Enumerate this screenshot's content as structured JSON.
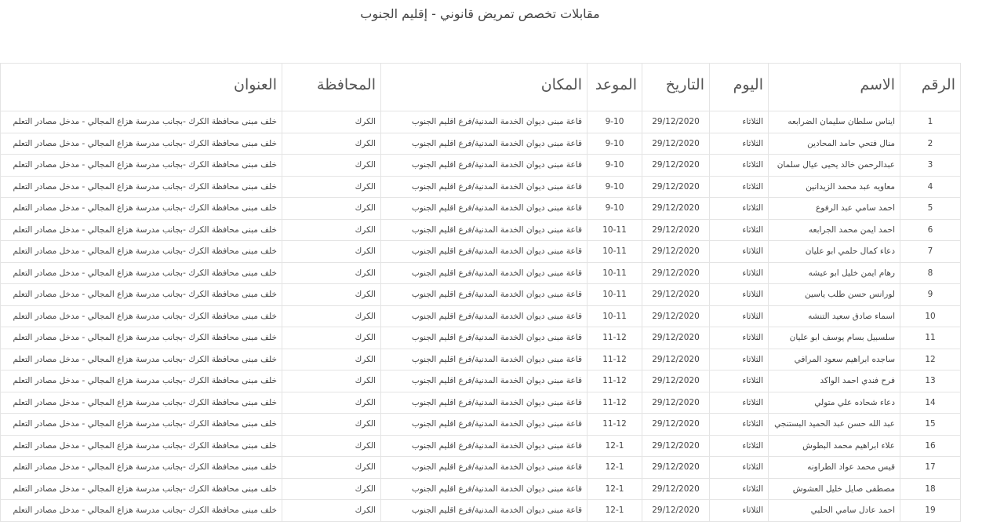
{
  "page": {
    "title": "مقابلات تخصص تمريض قانوني - إقليم الجنوب"
  },
  "table": {
    "headers": [
      "الرقم",
      "الاسم",
      "اليوم",
      "التاريخ",
      "الموعد",
      "المكان",
      "المحافظة",
      "العنوان"
    ],
    "rows": [
      [
        "1",
        "ايناس سلطان سليمان الضرابعه",
        "الثلاثاء",
        "29/12/2020",
        "9-10",
        "قاعة مبنى ديوان الخدمة المدنية/فرع اقليم الجنوب",
        "الكرك",
        "خلف مبنى محافظة الكرك -بجانب مدرسة هزاع المجالي - مدخل مصادر التعلم"
      ],
      [
        "2",
        "منال فتحي حامد المحادين",
        "الثلاثاء",
        "29/12/2020",
        "9-10",
        "قاعة مبنى ديوان الخدمة المدنية/فرع اقليم الجنوب",
        "الكرك",
        "خلف مبنى محافظة الكرك -بجانب مدرسة هزاع المجالي - مدخل مصادر التعلم"
      ],
      [
        "3",
        "عبدالرحمن خالد يحيى عيال سلمان",
        "الثلاثاء",
        "29/12/2020",
        "9-10",
        "قاعة مبنى ديوان الخدمة المدنية/فرع اقليم الجنوب",
        "الكرك",
        "خلف مبنى محافظة الكرك -بجانب مدرسة هزاع المجالي - مدخل مصادر التعلم"
      ],
      [
        "4",
        "معاويه عبد محمد الزيدانين",
        "الثلاثاء",
        "29/12/2020",
        "9-10",
        "قاعة مبنى ديوان الخدمة المدنية/فرع اقليم الجنوب",
        "الكرك",
        "خلف مبنى محافظة الكرك -بجانب مدرسة هزاع المجالي - مدخل مصادر التعلم"
      ],
      [
        "5",
        "احمد سامي عبد الرفوع",
        "الثلاثاء",
        "29/12/2020",
        "9-10",
        "قاعة مبنى ديوان الخدمة المدنية/فرع اقليم الجنوب",
        "الكرك",
        "خلف مبنى محافظة الكرك -بجانب مدرسة هزاع المجالي - مدخل مصادر التعلم"
      ],
      [
        "6",
        "احمد ايمن محمد الجرابعه",
        "الثلاثاء",
        "29/12/2020",
        "10-11",
        "قاعة مبنى ديوان الخدمة المدنية/فرع اقليم الجنوب",
        "الكرك",
        "خلف مبنى محافظة الكرك -بجانب مدرسة هزاع المجالي - مدخل مصادر التعلم"
      ],
      [
        "7",
        "دعاء كمال حلمي ابو عليان",
        "الثلاثاء",
        "29/12/2020",
        "10-11",
        "قاعة مبنى ديوان الخدمة المدنية/فرع اقليم الجنوب",
        "الكرك",
        "خلف مبنى محافظة الكرك -بجانب مدرسة هزاع المجالي - مدخل مصادر التعلم"
      ],
      [
        "8",
        "رهام ايمن خليل ابو عيشه",
        "الثلاثاء",
        "29/12/2020",
        "10-11",
        "قاعة مبنى ديوان الخدمة المدنية/فرع اقليم الجنوب",
        "الكرك",
        "خلف مبنى محافظة الكرك -بجانب مدرسة هزاع المجالي - مدخل مصادر التعلم"
      ],
      [
        "9",
        "لورانس حسن طلب ياسين",
        "الثلاثاء",
        "29/12/2020",
        "10-11",
        "قاعة مبنى ديوان الخدمة المدنية/فرع اقليم الجنوب",
        "الكرك",
        "خلف مبنى محافظة الكرك -بجانب مدرسة هزاع المجالي - مدخل مصادر التعلم"
      ],
      [
        "10",
        "اسماء صادق سعيد التنشه",
        "الثلاثاء",
        "29/12/2020",
        "10-11",
        "قاعة مبنى ديوان الخدمة المدنية/فرع اقليم الجنوب",
        "الكرك",
        "خلف مبنى محافظة الكرك -بجانب مدرسة هزاع المجالي - مدخل مصادر التعلم"
      ],
      [
        "11",
        "سلسبيل بسام يوسف ابو عليان",
        "الثلاثاء",
        "29/12/2020",
        "11-12",
        "قاعة مبنى ديوان الخدمة المدنية/فرع اقليم الجنوب",
        "الكرك",
        "خلف مبنى محافظة الكرك -بجانب مدرسة هزاع المجالي - مدخل مصادر التعلم"
      ],
      [
        "12",
        "ساجده ابراهيم سعود المرافي",
        "الثلاثاء",
        "29/12/2020",
        "11-12",
        "قاعة مبنى ديوان الخدمة المدنية/فرع اقليم الجنوب",
        "الكرك",
        "خلف مبنى محافظة الكرك -بجانب مدرسة هزاع المجالي - مدخل مصادر التعلم"
      ],
      [
        "13",
        "فرح فندي احمد الواكد",
        "الثلاثاء",
        "29/12/2020",
        "11-12",
        "قاعة مبنى ديوان الخدمة المدنية/فرع اقليم الجنوب",
        "الكرك",
        "خلف مبنى محافظة الكرك -بجانب مدرسة هزاع المجالي - مدخل مصادر التعلم"
      ],
      [
        "14",
        "دعاء شحاده علي متولي",
        "الثلاثاء",
        "29/12/2020",
        "11-12",
        "قاعة مبنى ديوان الخدمة المدنية/فرع اقليم الجنوب",
        "الكرك",
        "خلف مبنى محافظة الكرك -بجانب مدرسة هزاع المجالي - مدخل مصادر التعلم"
      ],
      [
        "15",
        "عبد الله حسن عبد الحميد البستنجي",
        "الثلاثاء",
        "29/12/2020",
        "11-12",
        "قاعة مبنى ديوان الخدمة المدنية/فرع اقليم الجنوب",
        "الكرك",
        "خلف مبنى محافظة الكرك -بجانب مدرسة هزاع المجالي - مدخل مصادر التعلم"
      ],
      [
        "16",
        "علاء ابراهيم محمد البطوش",
        "الثلاثاء",
        "29/12/2020",
        "12-1",
        "قاعة مبنى ديوان الخدمة المدنية/فرع اقليم الجنوب",
        "الكرك",
        "خلف مبنى محافظة الكرك -بجانب مدرسة هزاع المجالي - مدخل مصادر التعلم"
      ],
      [
        "17",
        "قيس محمد عواد الطراونه",
        "الثلاثاء",
        "29/12/2020",
        "12-1",
        "قاعة مبنى ديوان الخدمة المدنية/فرع اقليم الجنوب",
        "الكرك",
        "خلف مبنى محافظة الكرك -بجانب مدرسة هزاع المجالي - مدخل مصادر التعلم"
      ],
      [
        "18",
        "مصطفى صايل خليل العشوش",
        "الثلاثاء",
        "29/12/2020",
        "12-1",
        "قاعة مبنى ديوان الخدمة المدنية/فرع اقليم الجنوب",
        "الكرك",
        "خلف مبنى محافظة الكرك -بجانب مدرسة هزاع المجالي - مدخل مصادر التعلم"
      ],
      [
        "19",
        "احمد عادل سامي الحلبي",
        "الثلاثاء",
        "29/12/2020",
        "12-1",
        "قاعة مبنى ديوان الخدمة المدنية/فرع اقليم الجنوب",
        "الكرك",
        "خلف مبنى محافظة الكرك -بجانب مدرسة هزاع المجالي - مدخل مصادر التعلم"
      ]
    ]
  }
}
